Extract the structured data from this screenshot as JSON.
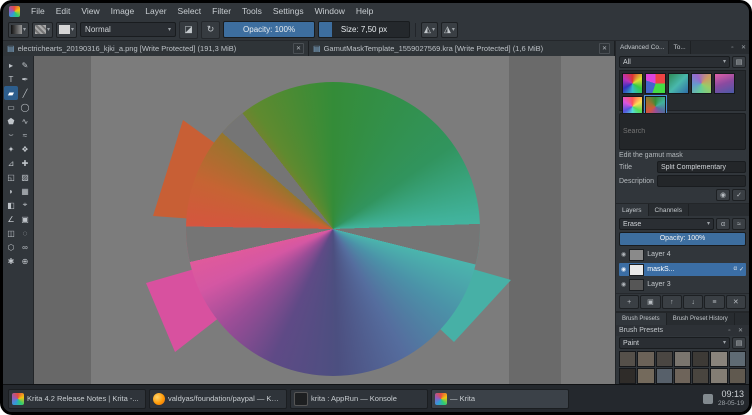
{
  "menubar": {
    "items": [
      "File",
      "Edit",
      "View",
      "Image",
      "Layer",
      "Select",
      "Filter",
      "Tools",
      "Settings",
      "Window",
      "Help"
    ]
  },
  "toolbar": {
    "blend_mode": "Normal",
    "opacity": "Opacity: 100%",
    "size": "Size: 7,50 px"
  },
  "tabs": [
    {
      "label": "electrichearts_20190316_kjki_a.png [Write Protected] (191,3 MiB)"
    },
    {
      "label": "GamutMaskTemplate_1559027569.kra [Write Protected] (1,6 MiB)"
    }
  ],
  "toolbox": {
    "tools": [
      {
        "name": "shape-select-tool",
        "g": "▸"
      },
      {
        "name": "edit-shapes-tool",
        "g": "✎"
      },
      {
        "name": "text-tool",
        "g": "T"
      },
      {
        "name": "calligraphy-tool",
        "g": "✒"
      },
      {
        "name": "freehand-brush-tool",
        "g": "▰"
      },
      {
        "name": "line-tool",
        "g": "╱"
      },
      {
        "name": "rectangle-tool",
        "g": "▭"
      },
      {
        "name": "ellipse-tool",
        "g": "◯"
      },
      {
        "name": "polygon-tool",
        "g": "⬟"
      },
      {
        "name": "polyline-tool",
        "g": "∿"
      },
      {
        "name": "bezier-tool",
        "g": "⌣"
      },
      {
        "name": "freehand-path-tool",
        "g": "≈"
      },
      {
        "name": "dynamic-brush-tool",
        "g": "✦"
      },
      {
        "name": "multibrush-tool",
        "g": "❖"
      },
      {
        "name": "transform-tool",
        "g": "⊿"
      },
      {
        "name": "move-tool",
        "g": "✚"
      },
      {
        "name": "crop-tool",
        "g": "◱"
      },
      {
        "name": "gradient-tool",
        "g": "▨"
      },
      {
        "name": "color-sampler-tool",
        "g": "◗"
      },
      {
        "name": "pattern-tool",
        "g": "▦"
      },
      {
        "name": "fill-tool",
        "g": "◧"
      },
      {
        "name": "assistants-tool",
        "g": "⌖"
      },
      {
        "name": "measure-tool",
        "g": "∠"
      },
      {
        "name": "reference-images-tool",
        "g": "▣"
      },
      {
        "name": "rect-select-tool",
        "g": "◫"
      },
      {
        "name": "ellipse-select-tool",
        "g": "◌"
      },
      {
        "name": "polygon-select-tool",
        "g": "⬡"
      },
      {
        "name": "freehand-select-tool",
        "g": "∞"
      },
      {
        "name": "similar-select-tool",
        "g": "✱"
      },
      {
        "name": "zoom-tool",
        "g": "⊕"
      }
    ]
  },
  "dock": {
    "tabs": [
      {
        "label": "Advanced Co..."
      },
      {
        "label": "To..."
      }
    ],
    "gamut": {
      "filter": "All",
      "search_placeholder": "Search",
      "edit_label": "Edit the gamut mask",
      "title_label": "Title",
      "title_value": "Split Complementary",
      "desc_label": "Description"
    },
    "layers": {
      "tab_layers": "Layers",
      "tab_channels": "Channels",
      "blend": "Erase",
      "opacity": "Opacity: 100%",
      "rows": [
        {
          "name": "Layer 4"
        },
        {
          "name": "maskS..."
        },
        {
          "name": "Layer 3"
        }
      ]
    },
    "brushes": {
      "tab_presets": "Brush Presets",
      "tab_history": "Brush Preset History",
      "title": "Brush Presets",
      "filter": "Paint"
    }
  },
  "taskbar": {
    "items": [
      {
        "label": "Krita 4.2 Release Notes | Krita -..."
      },
      {
        "label": "valdyas/foundation/paypal — KM..."
      },
      {
        "label": "krita : AppRun — Konsole"
      },
      {
        "label": "— Krita"
      }
    ],
    "time": "09:13",
    "date": "28-05-19"
  },
  "colors": {
    "accent_blue": "#3d6e9f",
    "selection_blue": "#3b6ea5",
    "canvas_gray": "#7c7c7c"
  },
  "icons": {
    "dropdown": "▾",
    "close": "✕",
    "eraser": "◪",
    "reload": "↻",
    "mirror_h": "◭",
    "mirror_v": "◮",
    "doc": "▤",
    "tag": "▤",
    "eye": "◉",
    "alpha": "α",
    "inherit": "≈",
    "add": "+",
    "duplicate": "▣",
    "up": "↑",
    "down": "↓",
    "props": "≡",
    "trash": "✕",
    "check": "✓",
    "preview": "◉",
    "float": "▫"
  }
}
